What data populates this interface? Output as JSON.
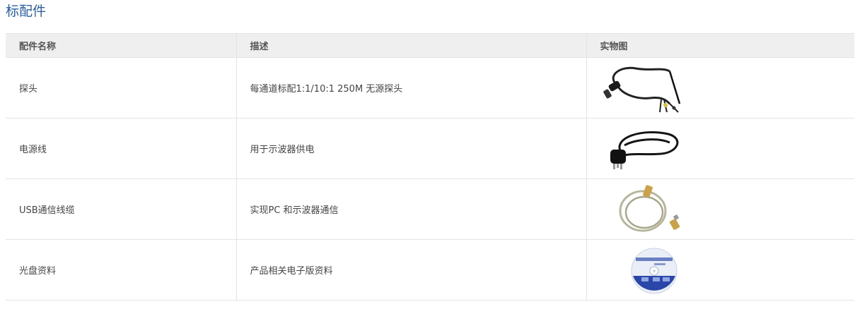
{
  "section_title": "标配件",
  "table": {
    "headers": [
      "配件名称",
      "描述",
      "实物图"
    ],
    "rows": [
      {
        "name": "探头",
        "desc": "每通道标配1:1/10:1 250M 无源探头",
        "image": "probe-image"
      },
      {
        "name": "电源线",
        "desc": "用于示波器供电",
        "image": "power-cord-image"
      },
      {
        "name": "USB通信线缆",
        "desc": "实现PC 和示波器通信",
        "image": "usb-cable-image"
      },
      {
        "name": "光盘资料",
        "desc": "产品相关电子版资料",
        "image": "cd-disc-image"
      }
    ]
  }
}
